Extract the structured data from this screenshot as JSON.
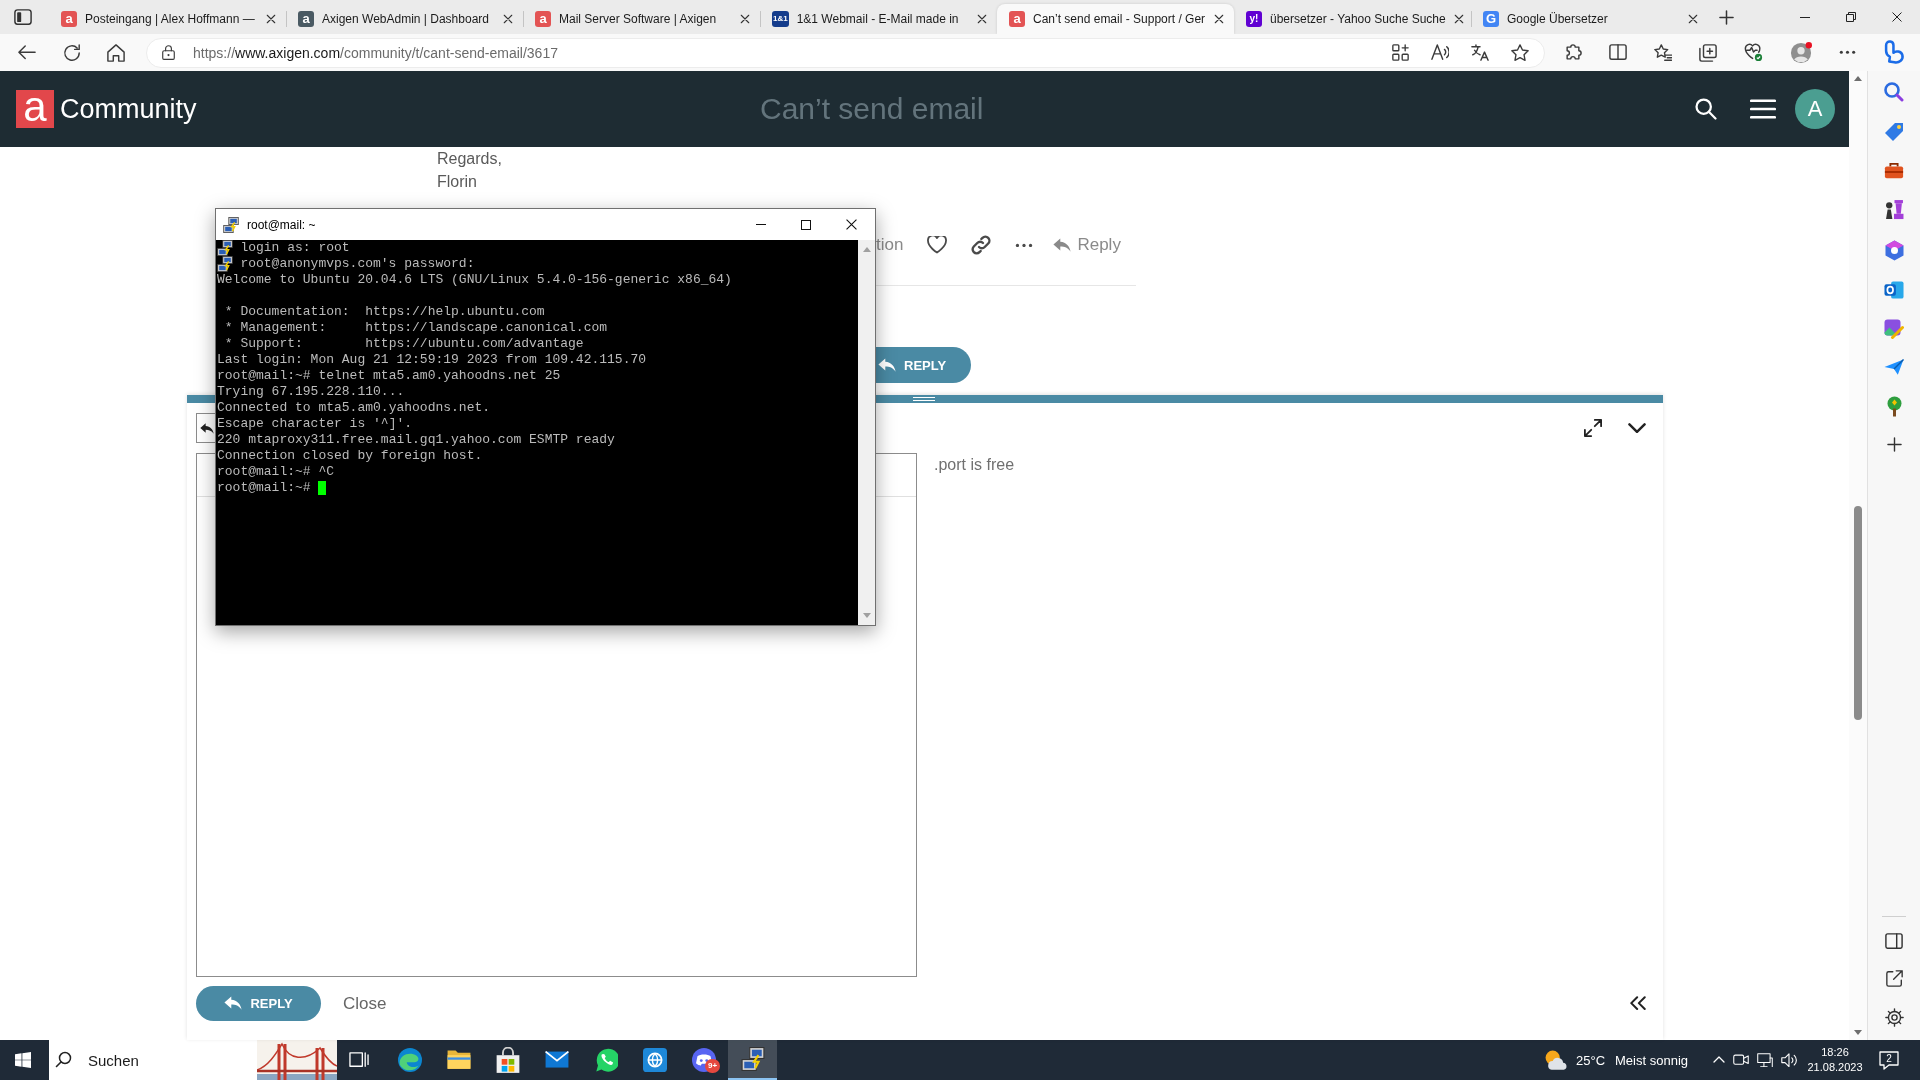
{
  "browser": {
    "tabs": [
      {
        "title": "Posteingang | Alex Hoffmann —",
        "favicon": "a",
        "color": "#e35454",
        "selected": false
      },
      {
        "title": "Axigen WebAdmin | Dashboard",
        "favicon": "a",
        "color": "#4a5a63",
        "selected": false
      },
      {
        "title": "Mail Server Software | Axigen",
        "favicon": "a",
        "color": "#e35454",
        "selected": false
      },
      {
        "title": "1&1 Webmail - E-Mail made in",
        "favicon": "1&1",
        "color": "#143c8c",
        "selected": false
      },
      {
        "title": "Can’t send email - Support / Ger",
        "favicon": "a",
        "color": "#e35455",
        "selected": true
      },
      {
        "title": "übersetzer - Yahoo Suche Suche",
        "favicon": "y!",
        "color": "#6001d2",
        "selected": false
      },
      {
        "title": "Google Übersetzer",
        "favicon": "G",
        "color": "#4285f4",
        "selected": false
      }
    ],
    "address": {
      "scheme": "https://",
      "host": "www.axigen.com",
      "path": "/community/t/cant-send-email/3617"
    }
  },
  "site_header": {
    "logo": "a",
    "site_name": "Community",
    "topic_title": "Can’t send email",
    "avatar": "A"
  },
  "post": {
    "lines": [
      "Regards,",
      "Florin"
    ],
    "action_fragment": "tion",
    "reply_link": "Reply",
    "reply_button": "REPLY"
  },
  "composer": {
    "preview": ".port is free",
    "reply_button": "REPLY",
    "close": "Close"
  },
  "terminal": {
    "title": "root@mail: ~",
    "blocks": [
      [
        {
          "kind": "session",
          "text": "login as: root"
        },
        {
          "kind": "session",
          "text": "root@anonymvps.com's password:"
        },
        {
          "kind": "output",
          "text": "Welcome to Ubuntu 20.04.6 LTS (GNU/Linux 5.4.0-156-generic x86_64)"
        }
      ],
      [
        {
          "kind": "output",
          "text": " * Documentation:  https://help.ubuntu.com"
        },
        {
          "kind": "output",
          "text": " * Management:     https://landscape.canonical.com"
        },
        {
          "kind": "output",
          "text": " * Support:        https://ubuntu.com/advantage"
        },
        {
          "kind": "output",
          "text": "Last login: Mon Aug 21 12:59:19 2023 from 109.42.115.70"
        },
        {
          "kind": "output",
          "text": "root@mail:~# telnet mta5.am0.yahoodns.net 25"
        },
        {
          "kind": "output",
          "text": "Trying 67.195.228.110..."
        },
        {
          "kind": "output",
          "text": "Connected to mta5.am0.yahoodns.net."
        },
        {
          "kind": "output",
          "text": "Escape character is '^]'."
        },
        {
          "kind": "output",
          "text": "220 mtaproxy311.free.mail.gq1.yahoo.com ESMTP ready"
        },
        {
          "kind": "output",
          "text": "Connection closed by foreign host."
        },
        {
          "kind": "output",
          "text": "root@mail:~# ^C"
        },
        {
          "kind": "output",
          "text": "root@mail:~#"
        }
      ]
    ],
    "cursor": true
  },
  "taskbar": {
    "search": {
      "placeholder": "Suchen"
    },
    "apps": [
      {
        "kind": "browser",
        "active": false
      },
      {
        "kind": "folder",
        "active": false
      },
      {
        "kind": "store",
        "active": false
      },
      {
        "kind": "mail",
        "active": false
      },
      {
        "kind": "chat",
        "active": false
      },
      {
        "kind": "web-app",
        "active": false
      },
      {
        "kind": "game-chat",
        "active": false,
        "badge": "9+"
      },
      {
        "kind": "terminal",
        "active": true
      }
    ],
    "weather": {
      "temperature": "25°C",
      "condition": "Meist sonnig"
    },
    "clock": {
      "time": "18:26",
      "date": "21.08.2023"
    },
    "notifications": "2"
  }
}
